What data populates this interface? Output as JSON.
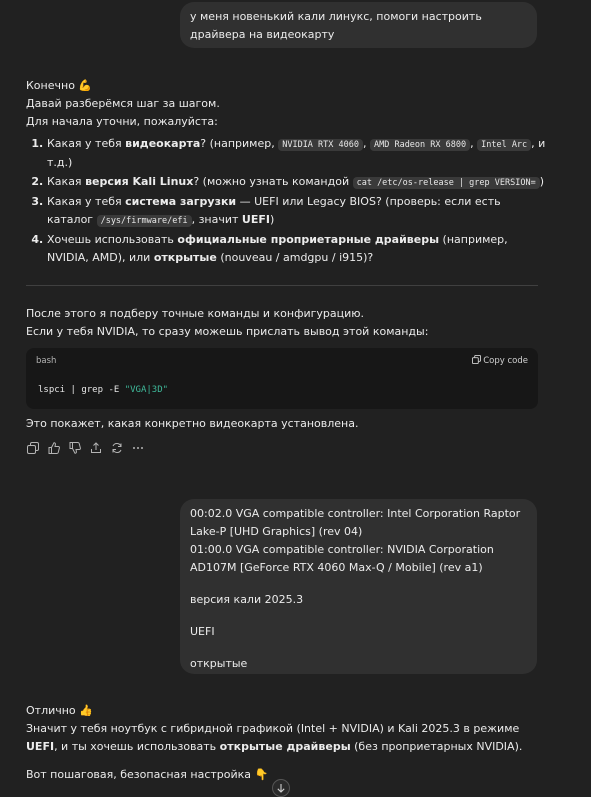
{
  "user_msg_1": "у меня новенький кали линукс, помоги настроить драйвера на видеокарту",
  "reply1": {
    "p1": "Конечно 💪",
    "p2": "Давай разберёмся шаг за шагом.",
    "p3": "Для начала уточни, пожалуйста:",
    "items": [
      {
        "a": "Какая у тебя ",
        "b": "видеокарта",
        "c": "? (например, ",
        "code1": "NVIDIA RTX 4060",
        "sep1": ", ",
        "code2": "AMD Radeon RX 6800",
        "sep2": ", ",
        "code3": "Intel Arc",
        "d": ", и т.д.)"
      },
      {
        "a": "Какая ",
        "b": "версия Kali Linux",
        "c": "? (можно узнать командой ",
        "code": "cat /etc/os-release | grep VERSION=",
        "d": ")"
      },
      {
        "a": "Какая у тебя ",
        "b": "система загрузки",
        "c": " — UEFI или Legacy BIOS? (проверь: если есть каталог ",
        "code": "/sys/firmware/efi",
        "d": ", значит ",
        "e": "UEFI",
        "f": ")"
      },
      {
        "a": "Хочешь использовать ",
        "b": "официальные проприетарные драйверы",
        "c": " (например, NVIDIA, AMD), или ",
        "d": "открытые",
        "e": " (nouveau / amdgpu / i915)?"
      }
    ],
    "after1": "После этого я подберу точные команды и конфигурацию.",
    "after2": "Если у тебя NVIDIA, то сразу можешь прислать вывод этой команды:",
    "code_lang": "bash",
    "copy_label": "Copy code",
    "code_cmd": "lspci | grep -E ",
    "code_str": "\"VGA|3D\"",
    "closing": "Это покажет, какая конкретно видеокарта установлена."
  },
  "user_msg_2": {
    "line1": "00:02.0 VGA compatible controller: Intel Corporation Raptor Lake-P [UHD Graphics] (rev 04)",
    "line2": "01:00.0 VGA compatible controller: NVIDIA Corporation AD107M [GeForce RTX 4060 Max-Q / Mobile] (rev a1)",
    "line3": "версия кали 2025.3",
    "line4": "UEFI",
    "line5": "открытые"
  },
  "reply2": {
    "p1": "Отлично 👍",
    "p2a": "Значит у тебя ноутбук с гибридной графикой (Intel + NVIDIA) и Kali 2025.3 в режиме ",
    "p2b": "UEFI",
    "p2c": ", и ты хочешь использовать ",
    "p2d": "открытые драйверы",
    "p2e": " (без проприетарных NVIDIA).",
    "p3": "Вот пошаговая, безопасная настройка 👇"
  }
}
